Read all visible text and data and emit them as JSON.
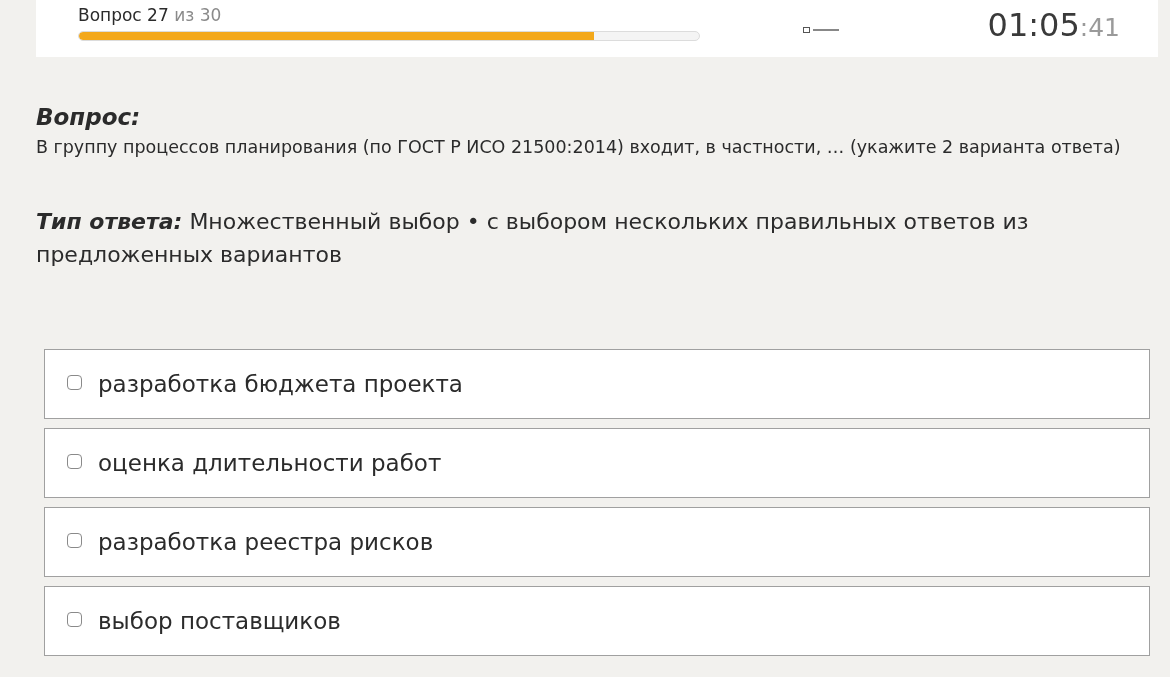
{
  "progress": {
    "label": "Вопрос 27",
    "total": "из 30",
    "level": 0.83
  },
  "timer": {
    "main": "01:05",
    "seconds": ":41"
  },
  "question": {
    "heading": "Вопрос:",
    "text": "В группу процессов планирования (по ГОСТ Р ИСО 21500:2014) входит, в частности, … (укажите 2 варианта ответа)"
  },
  "answer_type": {
    "heading": "Тип ответа:",
    "text": "Множественный выбор • с выбором нескольких правильных ответов из предложенных вариантов"
  },
  "options": [
    {
      "label": "разработка бюджета проекта",
      "checked": false
    },
    {
      "label": "оценка длительности работ",
      "checked": false
    },
    {
      "label": "разработка реестра рисков",
      "checked": false
    },
    {
      "label": "выбор поставщиков",
      "checked": false
    }
  ]
}
